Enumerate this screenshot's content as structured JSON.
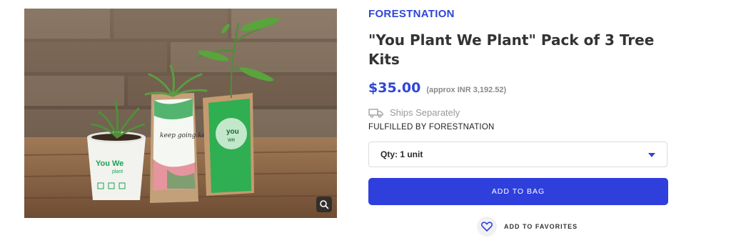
{
  "product": {
    "brand": "FORESTNATION",
    "title": "\"You Plant We Plant\" Pack of 3 Tree Kits",
    "price": "$35.00",
    "price_approx": "(approx INR 3,192.52)",
    "shipping_note": "Ships Separately",
    "fulfilled_by": "FULFILLED BY FORESTNATION"
  },
  "quantity": {
    "selected": "Qty: 1 unit"
  },
  "actions": {
    "add_to_bag": "ADD TO BAG",
    "add_to_favorites": "ADD TO FAVORITES"
  },
  "image": {
    "cup_text_1": "You",
    "cup_text_2": "We",
    "cup_text_3": "plant",
    "bag_left_text": "keep going keep growing",
    "bag_right_text": "you",
    "bag_right_text_2": "we"
  },
  "colors": {
    "accent": "#2f45d8",
    "button": "#2f3fdc",
    "caret": "#2f45d8"
  },
  "icons": [
    "zoom-icon",
    "truck-icon",
    "heart-icon",
    "caret-down-icon"
  ]
}
